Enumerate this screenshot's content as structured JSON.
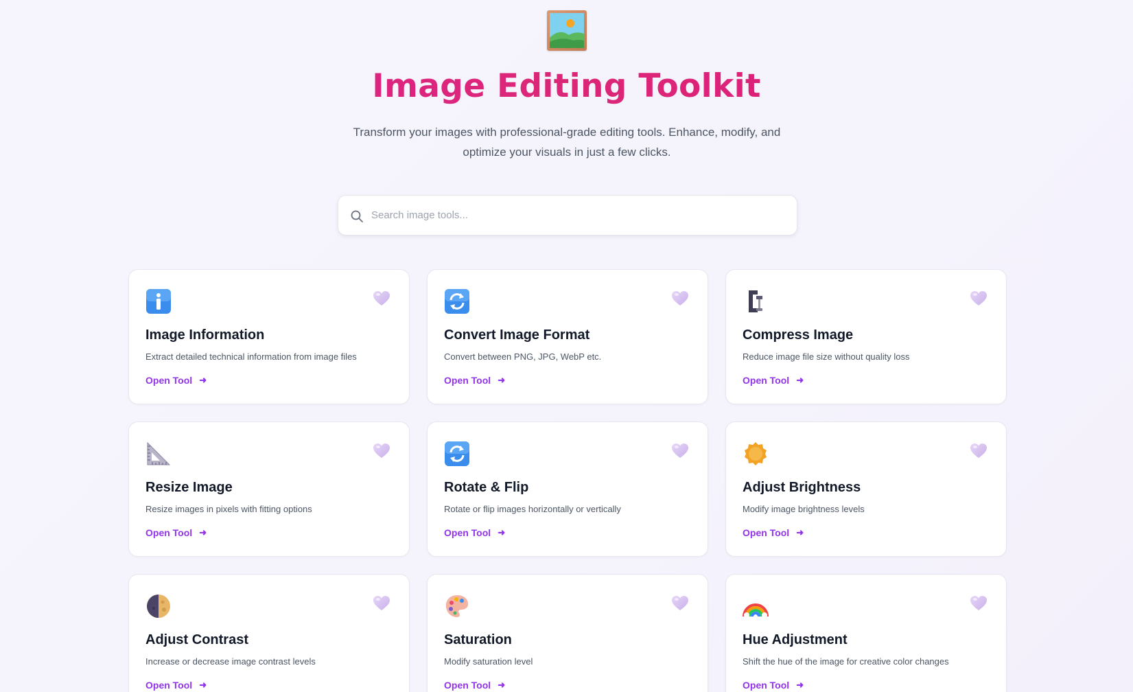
{
  "header": {
    "logo_icon": "framed-picture-icon",
    "title": "Image Editing Toolkit",
    "subtitle": "Transform your images with professional-grade editing tools. Enhance, modify, and optimize your visuals in just a few clicks."
  },
  "search": {
    "placeholder": "Search image tools...",
    "value": ""
  },
  "tools": [
    {
      "title": "Image Information",
      "description": "Extract detailed technical information from image files",
      "action": "Open Tool",
      "icon": "information-icon"
    },
    {
      "title": "Convert Image Format",
      "description": "Convert between PNG, JPG, WebP etc.",
      "action": "Open Tool",
      "icon": "refresh-arrows-icon"
    },
    {
      "title": "Compress Image",
      "description": "Reduce image file size without quality loss",
      "action": "Open Tool",
      "icon": "clamp-icon"
    },
    {
      "title": "Resize Image",
      "description": "Resize images in pixels with fitting options",
      "action": "Open Tool",
      "icon": "triangular-ruler-icon"
    },
    {
      "title": "Rotate & Flip",
      "description": "Rotate or flip images horizontally or vertically",
      "action": "Open Tool",
      "icon": "refresh-arrows-icon"
    },
    {
      "title": "Adjust Brightness",
      "description": "Modify image brightness levels",
      "action": "Open Tool",
      "icon": "sun-badge-icon"
    },
    {
      "title": "Adjust Contrast",
      "description": "Increase or decrease image contrast levels",
      "action": "Open Tool",
      "icon": "half-moon-icon"
    },
    {
      "title": "Saturation",
      "description": "Modify saturation level",
      "action": "Open Tool",
      "icon": "palette-icon"
    },
    {
      "title": "Hue Adjustment",
      "description": "Shift the hue of the image for creative color changes",
      "action": "Open Tool",
      "icon": "rainbow-icon"
    }
  ],
  "colors": {
    "title_gradient": [
      "#e11d8f",
      "#db2777"
    ],
    "accent": "#9333ea",
    "heart": "#d8c4f0"
  }
}
